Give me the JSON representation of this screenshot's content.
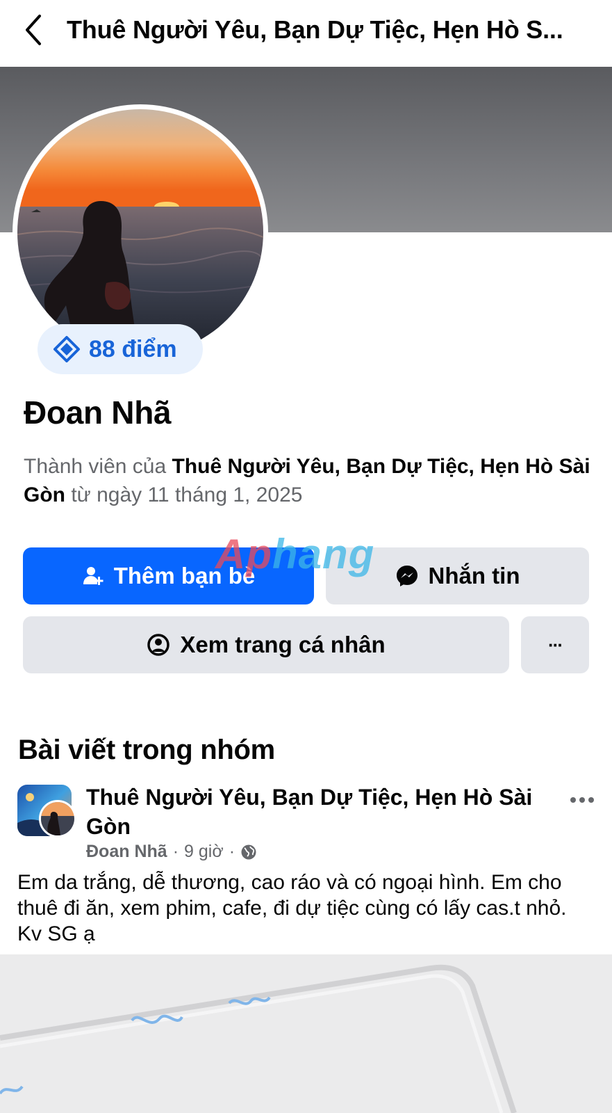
{
  "header": {
    "title": "Thuê Người Yêu, Bạn Dự Tiệc, Hẹn Hò S..."
  },
  "profile": {
    "points": "88 điểm",
    "name": "Đoan Nhã",
    "member_prefix": "Thành viên của ",
    "group_name": "Thuê Người Yêu, Bạn Dự Tiệc, Hẹn Hò Sài Gòn",
    "member_suffix": " từ ngày 11 tháng 1, 2025"
  },
  "actions": {
    "add_friend": "Thêm bạn bè",
    "message": "Nhắn tin",
    "view_profile": "Xem trang cá nhân",
    "more": "···"
  },
  "watermark": {
    "part1": "Ap",
    "part2": "hang"
  },
  "section": {
    "title": "Bài viết trong nhóm"
  },
  "post": {
    "group_name": "Thuê Người Yêu, Bạn Dự Tiệc, Hẹn Hò Sài Gòn",
    "author": "Đoan Nhã",
    "separator": "·",
    "time": "9 giờ",
    "body": "Em da trắng, dễ thương, cao ráo và có ngoại hình. Em cho thuê đi ăn, xem phim, cafe, đi dự tiệc cùng có lấy cas.t nhỏ. Kv SG ạ"
  },
  "colors": {
    "primary": "#0866ff",
    "secondary_button": "#e4e6eb",
    "badge_bg": "#e8f1fd",
    "badge_text": "#1864d8",
    "muted_text": "#65676b"
  },
  "icons": [
    "back-chevron-icon",
    "points-badge-icon",
    "add-friend-icon",
    "messenger-icon",
    "profile-circle-icon",
    "more-dots-icon",
    "globe-icon"
  ]
}
